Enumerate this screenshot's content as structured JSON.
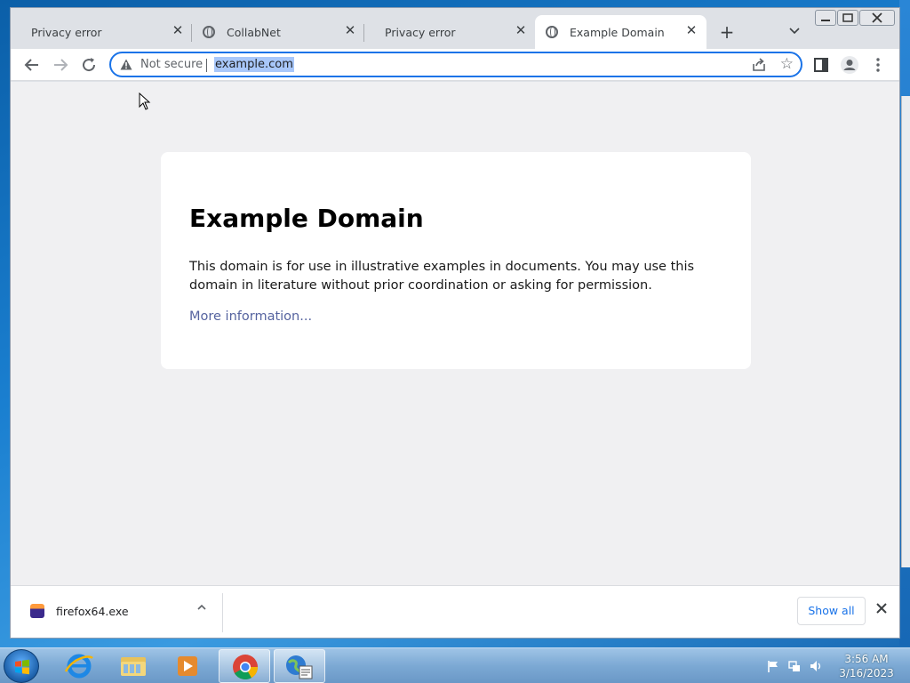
{
  "browser": {
    "tabs": [
      {
        "title": "Privacy error",
        "icon": null,
        "active": false
      },
      {
        "title": "CollabNet",
        "icon": "globe-icon",
        "active": false
      },
      {
        "title": "Privacy error",
        "icon": null,
        "active": false
      },
      {
        "title": "Example Domain",
        "icon": "globe-icon",
        "active": true
      }
    ],
    "omnibox": {
      "security_label": "Not secure",
      "url": "example.com"
    }
  },
  "page": {
    "heading": "Example Domain",
    "body": "This domain is for use in illustrative examples in documents. You may use this domain in literature without prior coordination or asking for permission.",
    "link": "More information..."
  },
  "downloads": {
    "file_name": "firefox64.exe",
    "show_all_label": "Show all"
  },
  "taskbar": {
    "time": "3:56 AM",
    "date": "3/16/2023"
  },
  "colors": {
    "accent": "#1a73e8",
    "link": "#38488f",
    "page_bg": "#f0f0f2"
  }
}
